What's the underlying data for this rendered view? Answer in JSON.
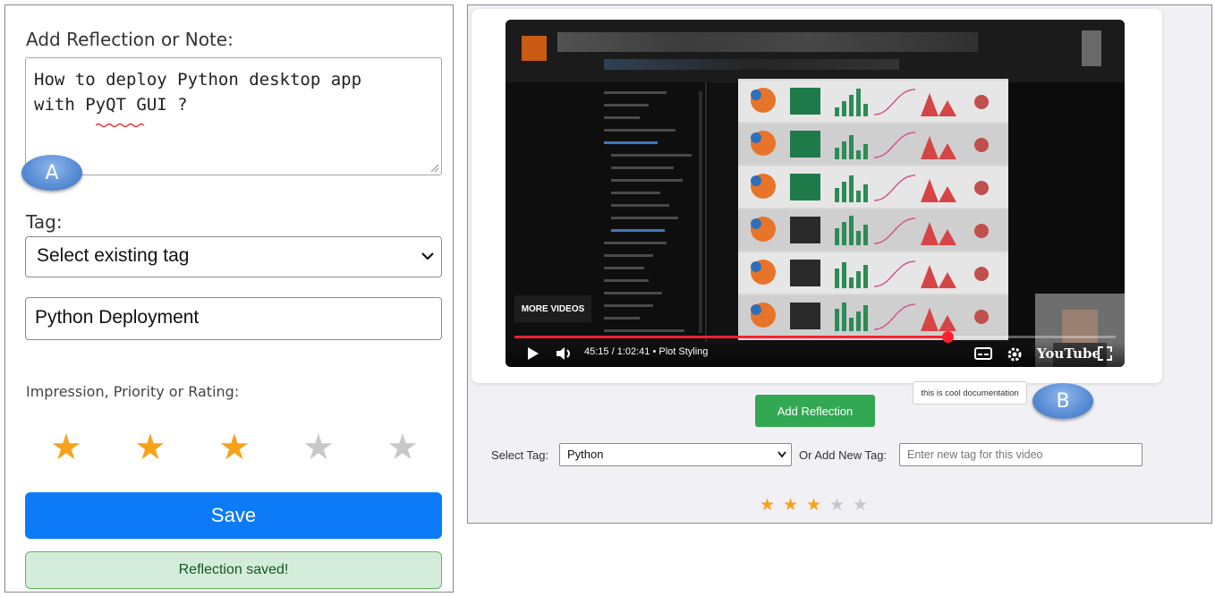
{
  "left": {
    "reflection_label": "Add Reflection or Note:",
    "reflection_text": "How to deploy Python desktop app\nwith PyQT GUI ?",
    "callout_a": "A",
    "tag_label": "Tag:",
    "tag_select_value": "Select existing tag",
    "new_tag_value": "Python Deployment",
    "rating_label": "Impression, Priority or Rating:",
    "rating": 3,
    "rating_max": 5,
    "save_label": "Save",
    "saved_message": "Reflection saved!"
  },
  "right": {
    "video": {
      "more_videos_label": "MORE VIDEOS",
      "time": "45:15 / 1:02:41 • Plot Styling",
      "progress": 0.72,
      "youtube_label": "YouTube"
    },
    "tooltip": "this is cool documentation",
    "callout_b": "B",
    "add_reflection_label": "Add Reflection",
    "select_tag_label": "Select Tag:",
    "select_tag_value": "Python",
    "or_add_label": "Or Add New Tag:",
    "new_tag_placeholder": "Enter new tag for this video",
    "rating": 3,
    "rating_max": 5
  },
  "colors": {
    "star_on": "#f7a21b",
    "star_off": "#c8c8c8",
    "save_blue": "#0d7bf7",
    "add_green": "#33a853",
    "progress_red": "#ff1f2f"
  },
  "icons": [
    "chevron-down-icon",
    "star-icon",
    "play-icon",
    "volume-icon",
    "captions-icon",
    "gear-icon",
    "fullscreen-icon",
    "resize-grip-icon"
  ]
}
